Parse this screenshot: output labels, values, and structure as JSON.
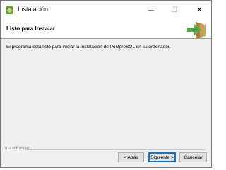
{
  "window": {
    "title": "Instalación",
    "minimize_glyph": "—",
    "maximize_glyph": "☐",
    "close_glyph": "✕"
  },
  "header": {
    "title": "Listo para Instalar"
  },
  "main": {
    "message": "El programa está listo para iniciar la instalación de PostgreSQL en su ordenador."
  },
  "footer": {
    "brand": "InstallBuilder",
    "back_label": "< Atrás",
    "next_label": "Siguiente >",
    "cancel_label": "Cancelar"
  },
  "colors": {
    "logo_green": "#5aa84d",
    "logo_tan": "#c8a15b",
    "focus_border": "#0078d7"
  }
}
